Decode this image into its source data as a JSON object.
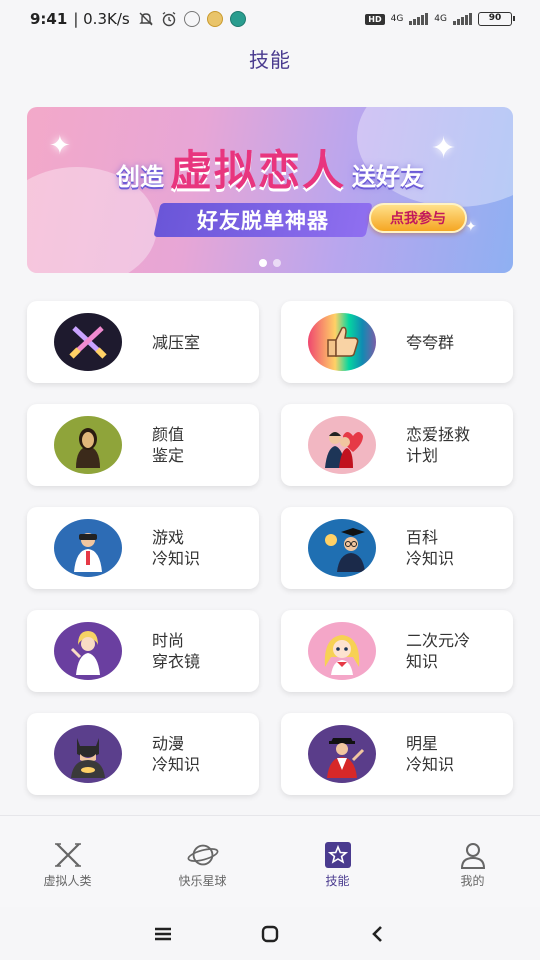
{
  "status_bar": {
    "time": "9:41",
    "net_speed": "| 0.3K/s",
    "hd": "HD",
    "net1": "4G",
    "net2": "4G",
    "battery": "90"
  },
  "header": {
    "title": "技能"
  },
  "banner": {
    "prefix": "创造",
    "highlight": "虚拟恋人",
    "suffix": "送好友",
    "subtitle": "好友脱单神器",
    "cta_label": "点我参与",
    "page_count": 2,
    "active_page": 1
  },
  "skills": [
    {
      "label": "减压室",
      "icon": "crossed-swords-icon"
    },
    {
      "label": "夸夸群",
      "icon": "thumbs-up-icon"
    },
    {
      "label": "颜值\n鉴定",
      "icon": "mona-lisa-icon"
    },
    {
      "label": "恋爱拯救\n计划",
      "icon": "couple-icon"
    },
    {
      "label": "游戏\n冷知识",
      "icon": "gamer-icon"
    },
    {
      "label": "百科\n冷知识",
      "icon": "scholar-icon"
    },
    {
      "label": "时尚\n穿衣镜",
      "icon": "fashion-woman-icon"
    },
    {
      "label": "二次元冷\n知识",
      "icon": "anime-girl-icon"
    },
    {
      "label": "动漫\n冷知识",
      "icon": "batman-icon"
    },
    {
      "label": "明星\n冷知识",
      "icon": "star-performer-icon"
    }
  ],
  "bottom_nav": [
    {
      "label": "虚拟人类",
      "icon": "x-icon",
      "active": false
    },
    {
      "label": "快乐星球",
      "icon": "planet-icon",
      "active": false
    },
    {
      "label": "技能",
      "icon": "star-box-icon",
      "active": true
    },
    {
      "label": "我的",
      "icon": "person-icon",
      "active": false
    }
  ],
  "colors": {
    "accent": "#4a3b8f",
    "background": "#f6f6f8",
    "card": "#ffffff",
    "banner_pink": "#f3a9c9",
    "banner_blue": "#8fb0f2"
  }
}
